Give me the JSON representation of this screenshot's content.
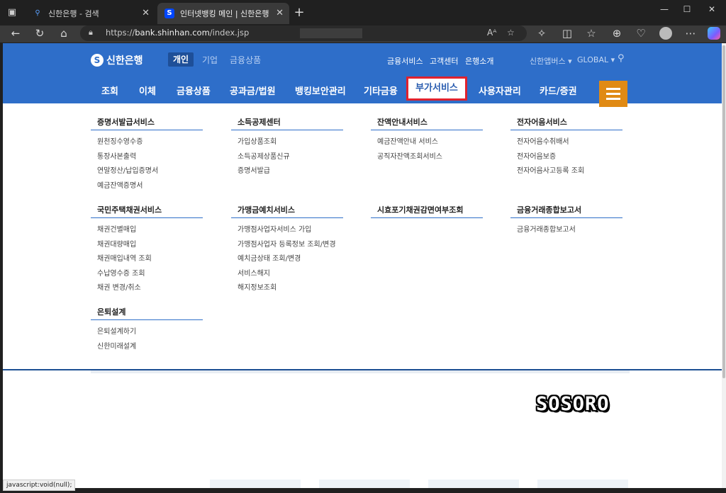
{
  "browser": {
    "tabs": [
      {
        "title": "신한은행 - 검색",
        "favicon": "search-icon"
      },
      {
        "title": "인터넷뱅킹 메인 | 신한은행 개인",
        "favicon": "shinhan-favicon"
      }
    ],
    "url_host": "bank.shinhan.com",
    "url_scheme": "https://",
    "url_path": "/index.jsp",
    "status_text": "javascript:void(null);"
  },
  "header": {
    "logo": "신한은행",
    "segments": [
      "개인",
      "기업",
      "금융상품"
    ],
    "util_links": [
      "금융서비스",
      "고객센터",
      "은행소개"
    ],
    "family": "신한앱버스",
    "global": "GLOBAL",
    "gnb": [
      "조회",
      "이체",
      "금융상품",
      "공과금/법원",
      "뱅킹보안관리",
      "기타금융",
      "부가서비스",
      "사용자관리",
      "카드/증권"
    ],
    "selected_gnb": "부가서비스"
  },
  "menu": {
    "col1": {
      "g1_title": "증명서발급서비스",
      "g1_items": [
        "원천징수영수증",
        "통장사본출력",
        "연말정산/납입증명서",
        "예금잔액증명서"
      ],
      "g2_title": "국민주택채권서비스",
      "g2_items": [
        "채권건별매입",
        "채권대량매입",
        "채권매입내역 조회",
        "수납영수증 조회",
        "채권 변경/취소"
      ],
      "g3_title": "은퇴설계",
      "g3_items": [
        "은퇴설계하기",
        "신한미래설계"
      ]
    },
    "col2": {
      "g1_title": "소득공제센터",
      "g1_items": [
        "가입상품조회",
        "소득공제상품신규",
        "증명서발급"
      ],
      "g2_title": "가맹금예치서비스",
      "g2_items": [
        "가맹점사업자서비스 가입",
        "가맹점사업자 등록정보 조회/변경",
        "예치금상태 조회/변경",
        "서비스해지",
        "해지정보조회"
      ]
    },
    "col3": {
      "g1_title": "잔액안내서비스",
      "g1_items": [
        "예금잔액안내 서비스",
        "공직자잔액조회서비스"
      ],
      "g2_title": "시효포기채권감면여부조회"
    },
    "col4": {
      "g1_title": "전자어음서비스",
      "g1_items": [
        "전자어음수취배서",
        "전자어음보증",
        "전자어음사고등록 조회"
      ],
      "g2_title": "금융거래종합보고서",
      "g2_items": [
        "금융거래종합보고서"
      ]
    }
  },
  "watermark": "SOSORO",
  "colors": {
    "brand_blue": "#2e6ec9",
    "highlight_red": "#e0222e",
    "hamburger_orange": "#e08a14"
  }
}
